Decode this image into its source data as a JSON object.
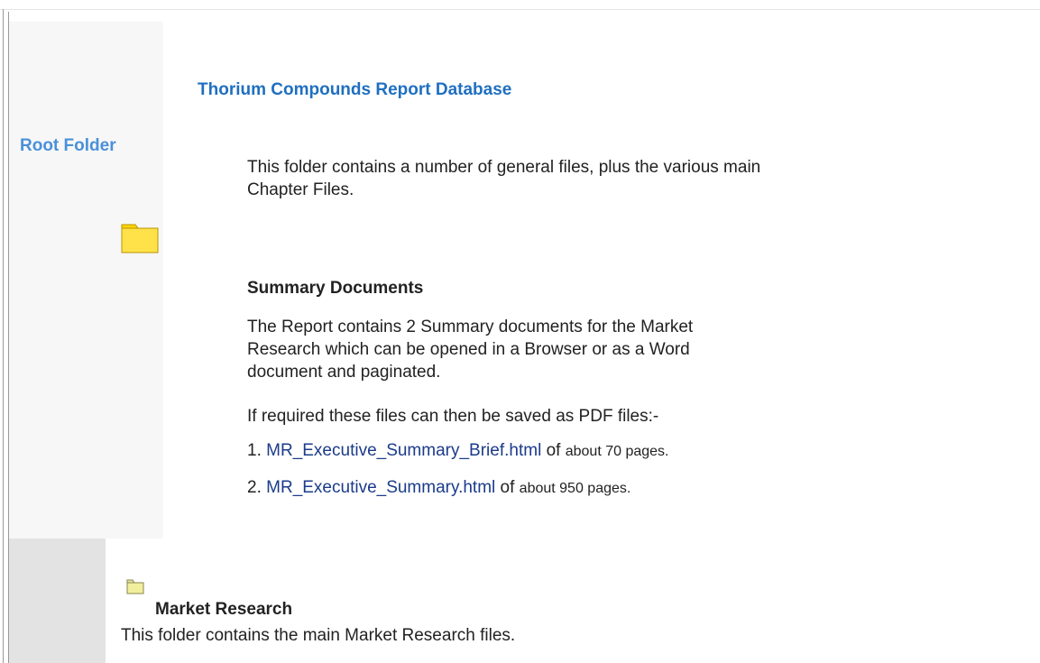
{
  "sidebar": {
    "root_label": "Root Folder"
  },
  "report": {
    "title": "Thorium Compounds Report Database",
    "intro": "This folder contains a number of general files, plus the various main Chapter Files."
  },
  "summary": {
    "heading": "Summary Documents",
    "text": "The Report contains 2 Summary documents for the Market Research which can be opened in a Browser or as a Word document and paginated.",
    "required": "If required these files can then be saved as PDF files:-",
    "documents": [
      {
        "number": "1.",
        "name": "MR_Executive_Summary_Brief.html",
        "of": "of",
        "pages": "about 70 pages."
      },
      {
        "number": "2.",
        "name": "MR_Executive_Summary.html",
        "of": "of",
        "pages": "about 950 pages."
      }
    ]
  },
  "market_research": {
    "heading": "Market Research",
    "text": "This folder contains the main Market Research files."
  },
  "icons": {
    "root_folder": "folder-icon",
    "market_folder": "folder-icon"
  },
  "colors": {
    "title": "#1f6fc0",
    "root_label": "#4a90d9",
    "link": "#1b3b8a",
    "folder_fill": "#ffd400"
  }
}
